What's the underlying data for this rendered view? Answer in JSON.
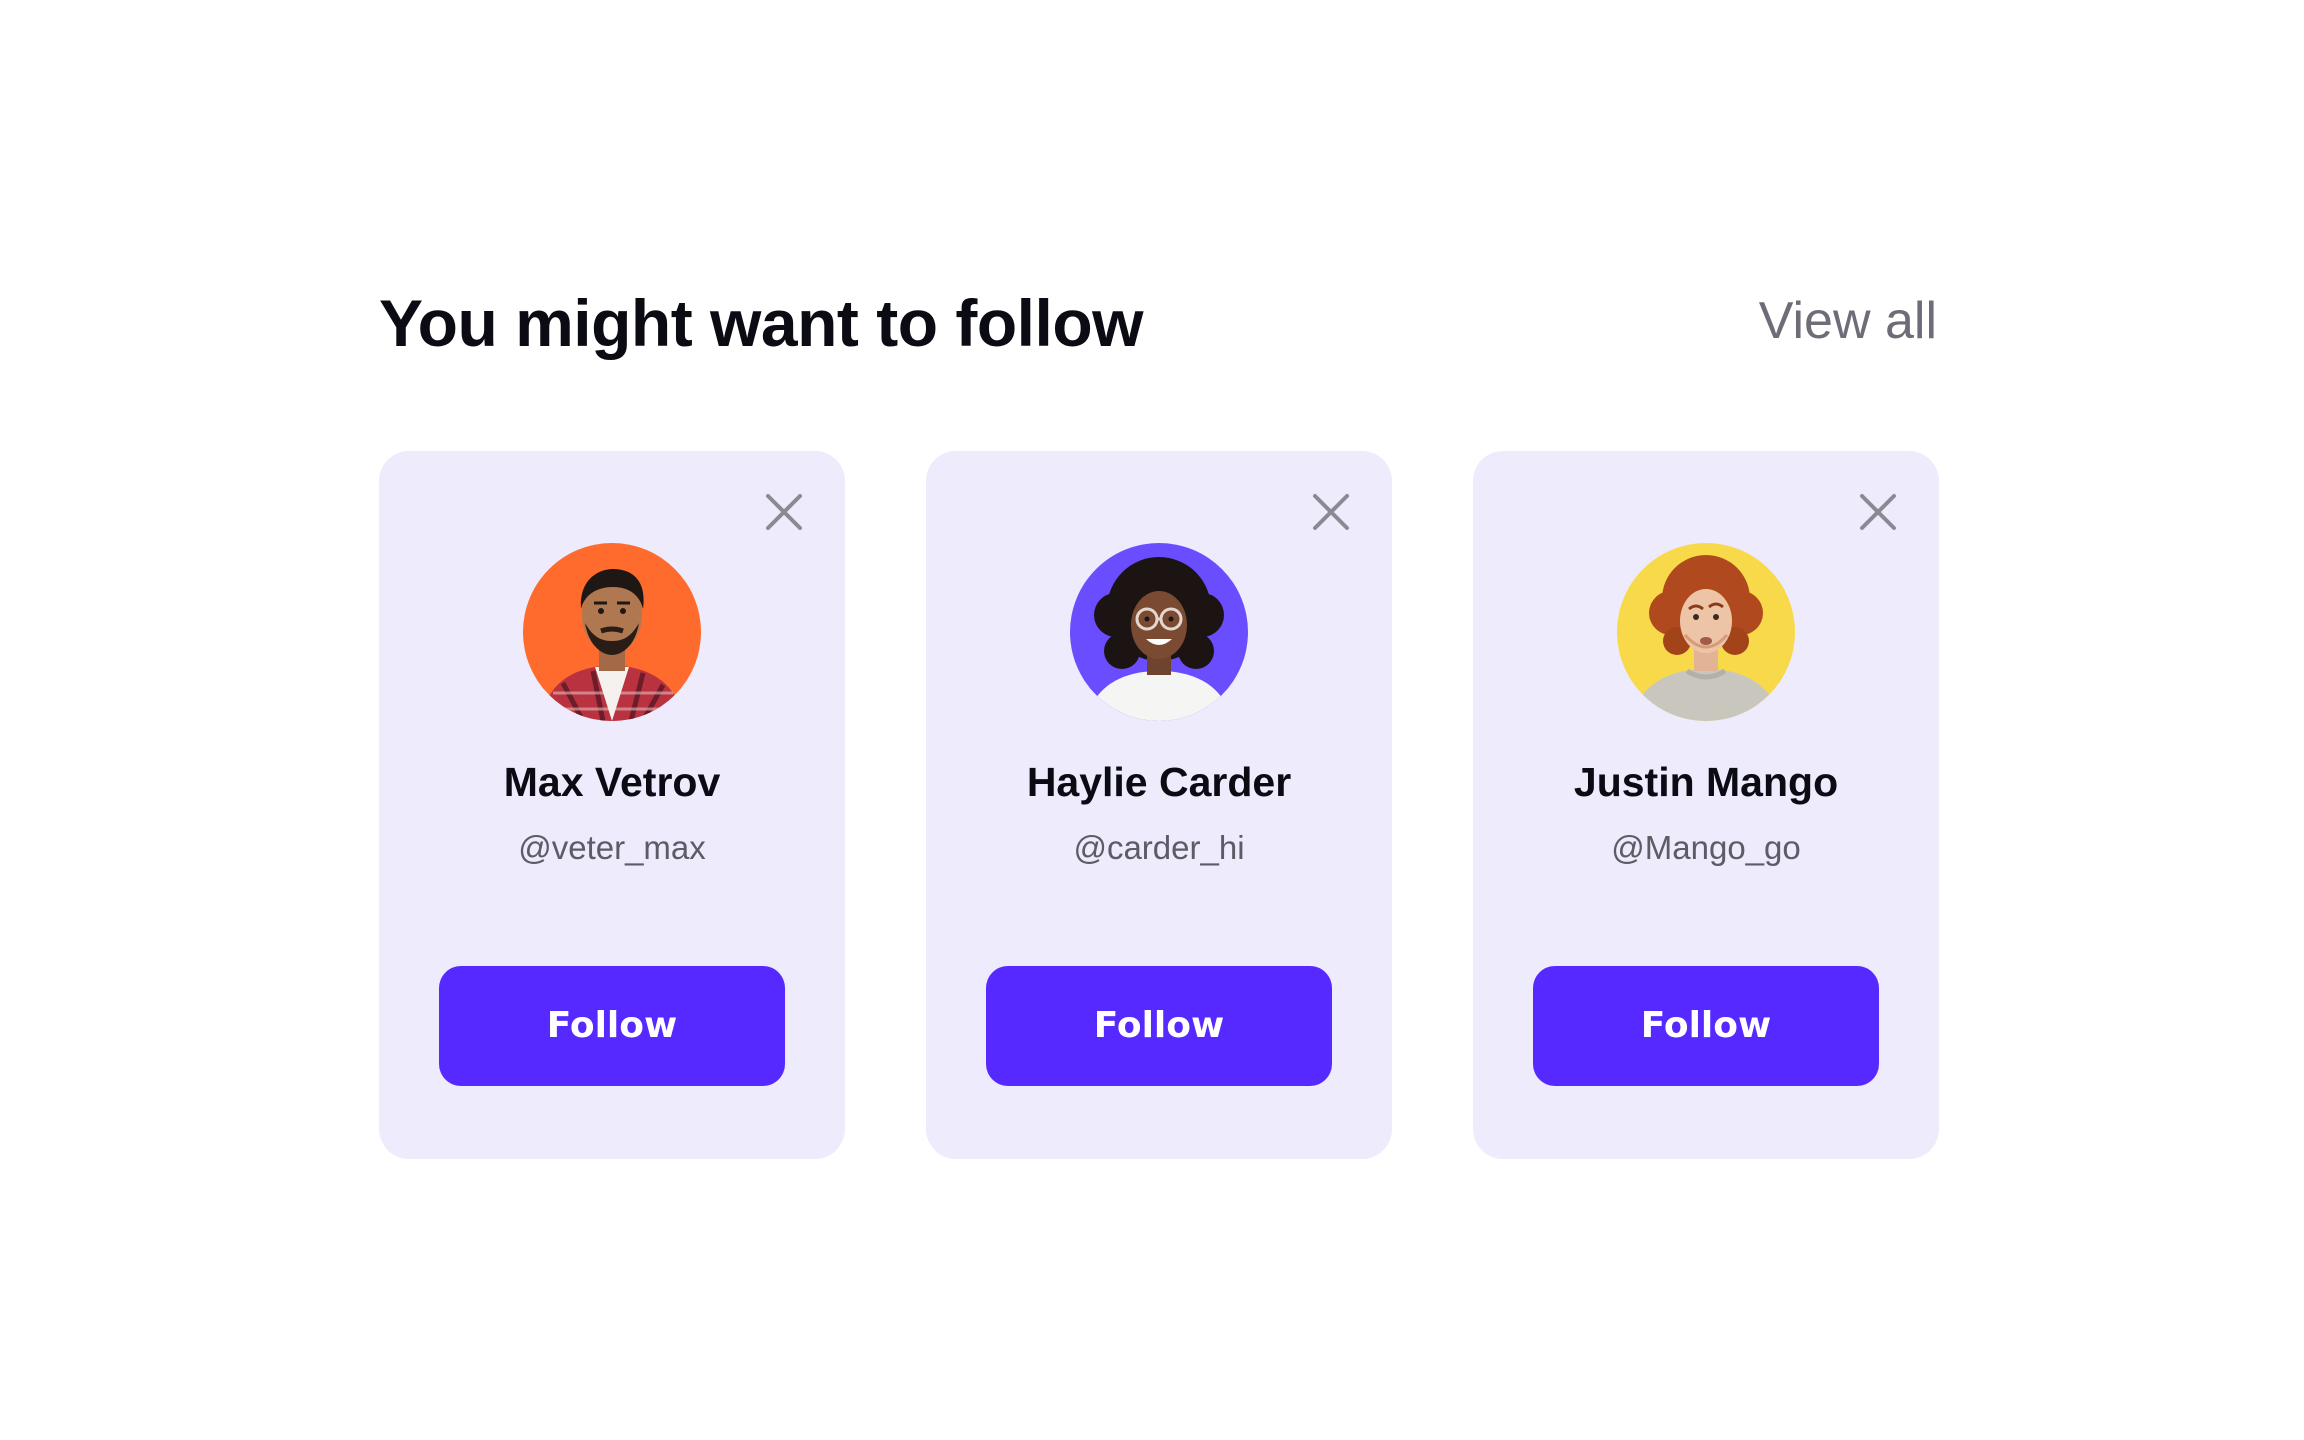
{
  "section": {
    "title": "You might want to follow",
    "view_all_label": "View all"
  },
  "colors": {
    "card_background": "#edebfc",
    "follow_button": "#5529ff",
    "follow_text": "#ffffff",
    "title_text": "#0b0b14",
    "secondary_text": "#6d6d78"
  },
  "suggestions": [
    {
      "name": "Max Vetrov",
      "handle": "@veter_max",
      "follow_label": "Follow",
      "avatar_background": "#ff6b2c",
      "dismiss_icon": "close-icon"
    },
    {
      "name": "Haylie Carder",
      "handle": "@carder_hi",
      "follow_label": "Follow",
      "avatar_background": "#6a4dff",
      "dismiss_icon": "close-icon"
    },
    {
      "name": "Justin Mango",
      "handle": "@Mango_go",
      "follow_label": "Follow",
      "avatar_background": "#f7d94a",
      "dismiss_icon": "close-icon"
    }
  ]
}
